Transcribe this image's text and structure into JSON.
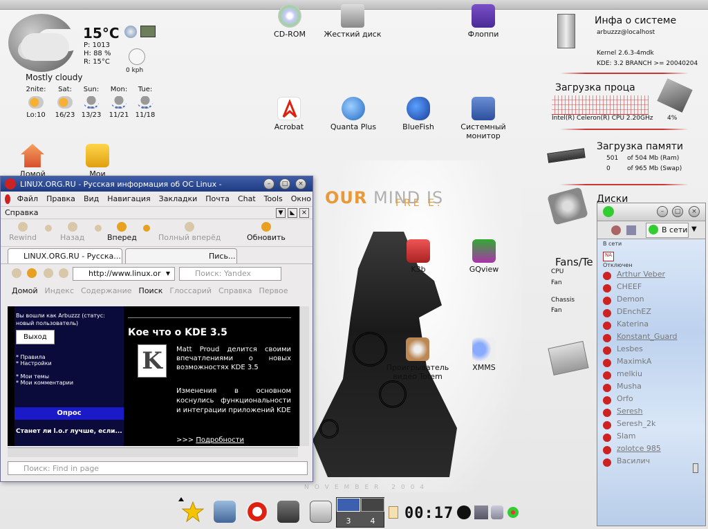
{
  "weather": {
    "temp": "15°C",
    "pressure": "P: 1013",
    "humidity": "H: 88 %",
    "real": "R: 15°C",
    "wind": "0 kph",
    "condition": "Mostly cloudy",
    "days": [
      {
        "name": "2nite:",
        "temp": "Lo:10"
      },
      {
        "name": "Sat:",
        "temp": "16/23"
      },
      {
        "name": "Sun:",
        "temp": "13/23"
      },
      {
        "name": "Mon:",
        "temp": "11/21"
      },
      {
        "name": "Tue:",
        "temp": "11/18"
      }
    ]
  },
  "desktop_icons": {
    "cdrom": "CD-ROM",
    "hdd": "Жесткий диск",
    "floppy": "Флоппи",
    "acrobat": "Acrobat",
    "quanta": "Quanta Plus",
    "bluefish": "BlueFish",
    "sysmon_line1": "Системный",
    "sysmon_line2": "монитор",
    "home": "Домой",
    "mydocs": "Мои документы",
    "k3b": "K3b",
    "gqview": "GQview",
    "totem_line1": "Проигрыватель",
    "totem_line2": "видео Totem",
    "xmms": "XMMS"
  },
  "poster": {
    "our": "OUR",
    "mind": "MIND IS",
    "free": "FRE E.",
    "november": "NOVEMBER 2004"
  },
  "sysinfo": {
    "title": "Инфа о системе",
    "user": "arbuzzz@localhost",
    "kernel": "Kernel 2.6.3-4mdk",
    "kde": "KDE: 3.2 BRANCH >= 20040204",
    "cpu_title": "Загрузка проца",
    "cpu_model": "Intel(R) Celeron(R) CPU 2.20GHz",
    "cpu_load": "4%",
    "mem_title": "Загрузка памяти",
    "ram_used": "501",
    "ram_total": "of 504 Mb (Ram)",
    "swap_used": "0",
    "swap_total": "of 965 Mb (Swap)",
    "disks_title": "Диски",
    "fans_title": "Fans/Te",
    "cpu_label": "CPU",
    "fan_label1": "Fan",
    "chassis_label": "Chassis",
    "fan_label2": "Fan"
  },
  "browser": {
    "title": "LINUX.ORG.RU - Русская информация об ОС Linux -",
    "menu": [
      "Файл",
      "Правка",
      "Вид",
      "Навигация",
      "Закладки",
      "Почта",
      "Chat",
      "Tools",
      "Окно"
    ],
    "spravka": "Справка",
    "nav": {
      "rewind": "Rewind",
      "back": "Назад",
      "forward": "Вперед",
      "fastforward": "Полный вперёд",
      "reload": "Обновить"
    },
    "tabs": [
      "LINUX.ORG.RU - Русска...",
      "Пись..."
    ],
    "url": "http://www.linux.or",
    "search_placeholder": "Поиск: Yandex",
    "links": [
      "Домой",
      "Индекс",
      "Содержание",
      "Поиск",
      "Глоссарий",
      "Справка",
      "Первое"
    ],
    "login_text": "Вы вошли как Arbuzzz (статус: новый пользователь)",
    "logout": "Выход",
    "side_links": [
      "* Правила",
      "* Настройки",
      "* Мои темы",
      "* Мои комментарии"
    ],
    "poll_title": "Опрос",
    "poll_question": "Станет ли l.o.r лучше, если...",
    "article_title": "Кое что о KDE 3.5",
    "article_p1": "Matt Proud делится своими впечатлениями о новых возможностях KDE 3.5",
    "article_p2": "Изменения в основном коснулись функциональности и интеграции приложений KDE",
    "more_prefix": ">>>",
    "more": "Подробности",
    "find_placeholder": "Поиск: Find in page"
  },
  "im": {
    "toolbar_label": "В сети",
    "section_online": "В сети",
    "section_offline": "Отключен",
    "contacts": [
      "Arthur Veber",
      "CHEEF",
      "Demon",
      "DEnchEZ",
      "Katerina",
      "Konstant_Guard",
      "Lesbes",
      "MaximkA",
      "melkiu",
      "Musha",
      "Orfo",
      "Seresh",
      "Seresh_2k",
      "Slam",
      "zolotce 985",
      "Василич"
    ]
  },
  "taskbar": {
    "desk3": "3",
    "desk4": "4",
    "clock": "00:17"
  }
}
